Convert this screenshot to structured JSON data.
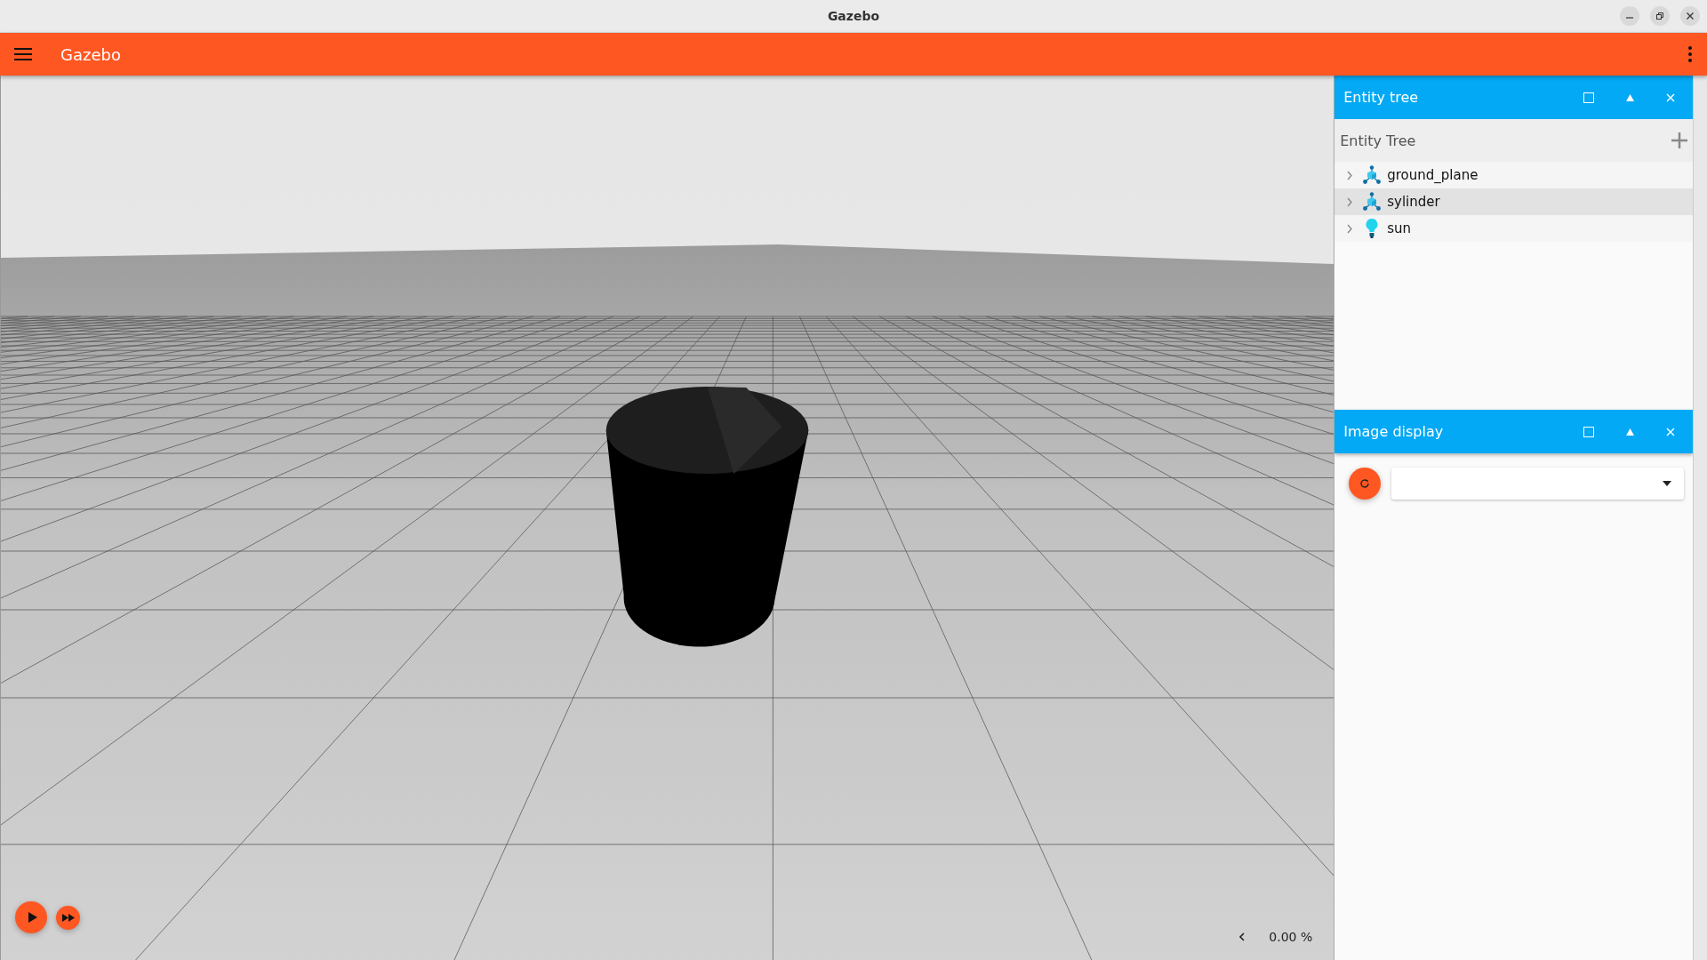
{
  "window": {
    "title": "Gazebo"
  },
  "toolbar": {
    "title": "Gazebo"
  },
  "panels": [
    {
      "kind": "tree",
      "title": "Entity tree",
      "heading": "Entity Tree",
      "items": [
        {
          "name": "ground_plane",
          "kind": "model",
          "expanded": false,
          "selected": false
        },
        {
          "name": "sylinder",
          "kind": "model",
          "expanded": false,
          "selected": true
        },
        {
          "name": "sun",
          "kind": "light",
          "expanded": false,
          "selected": false
        }
      ]
    },
    {
      "kind": "image",
      "title": "Image display"
    }
  ],
  "playback": {
    "zoom_reading": "0.00 %"
  }
}
